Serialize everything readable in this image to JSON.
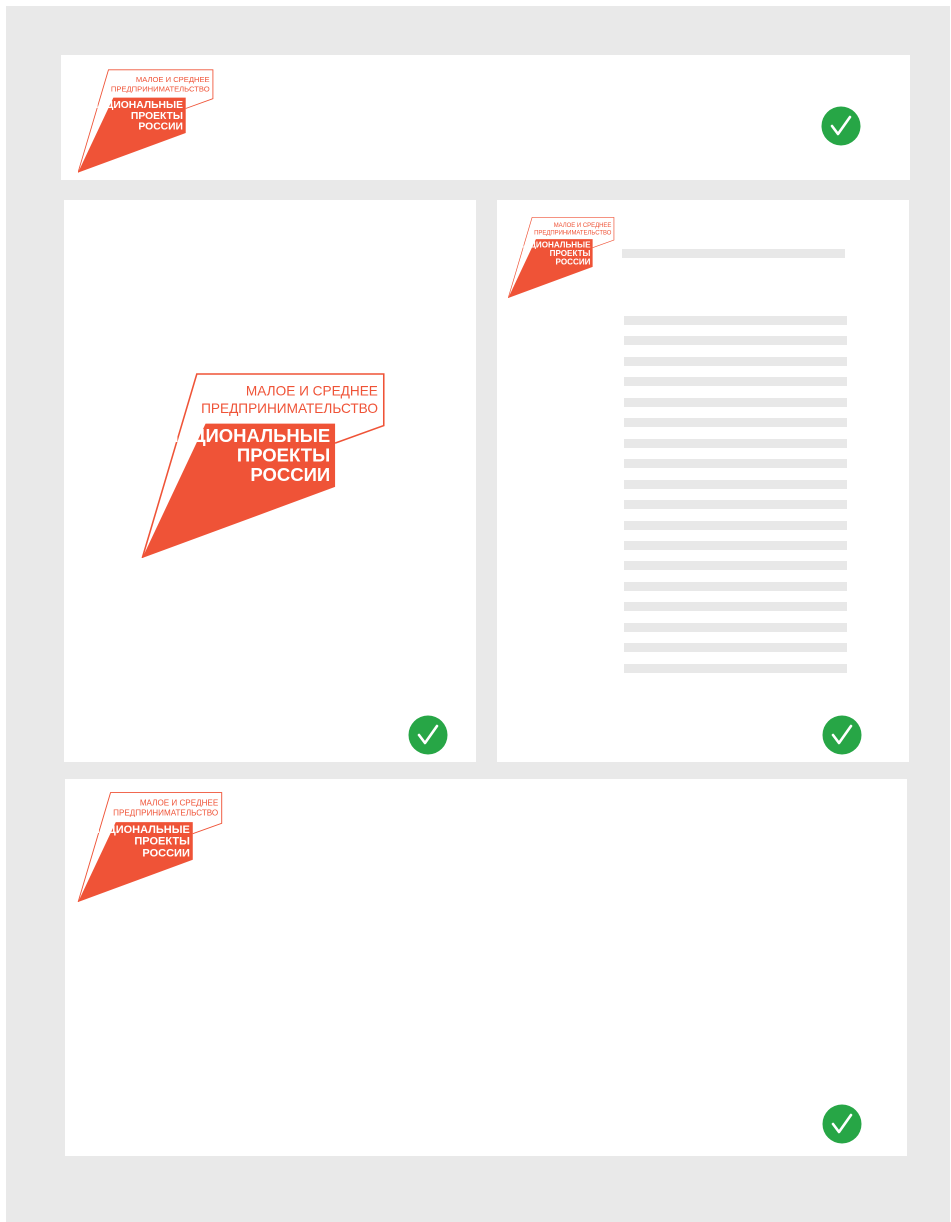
{
  "logo": {
    "line1": "МАЛОЕ И СРЕДНЕЕ",
    "line2": "ПРЕДПРИНИМАТЕЛЬСТВО",
    "line3": "НАЦИОНАЛЬНЫЕ",
    "line4": "ПРОЕКТЫ",
    "line5": "РОССИИ"
  },
  "colors": {
    "brand": "#ef5337",
    "check": "#27a646",
    "background": "#e9e9e9",
    "placeholder": "#e8e8e8"
  },
  "icons": {
    "approved": "check-circle-icon"
  },
  "examples": [
    {
      "name": "horizontal-banner",
      "status": "approved"
    },
    {
      "name": "vertical-center-logo",
      "status": "approved"
    },
    {
      "name": "document-with-text",
      "status": "approved"
    },
    {
      "name": "wide-banner",
      "status": "approved"
    }
  ]
}
